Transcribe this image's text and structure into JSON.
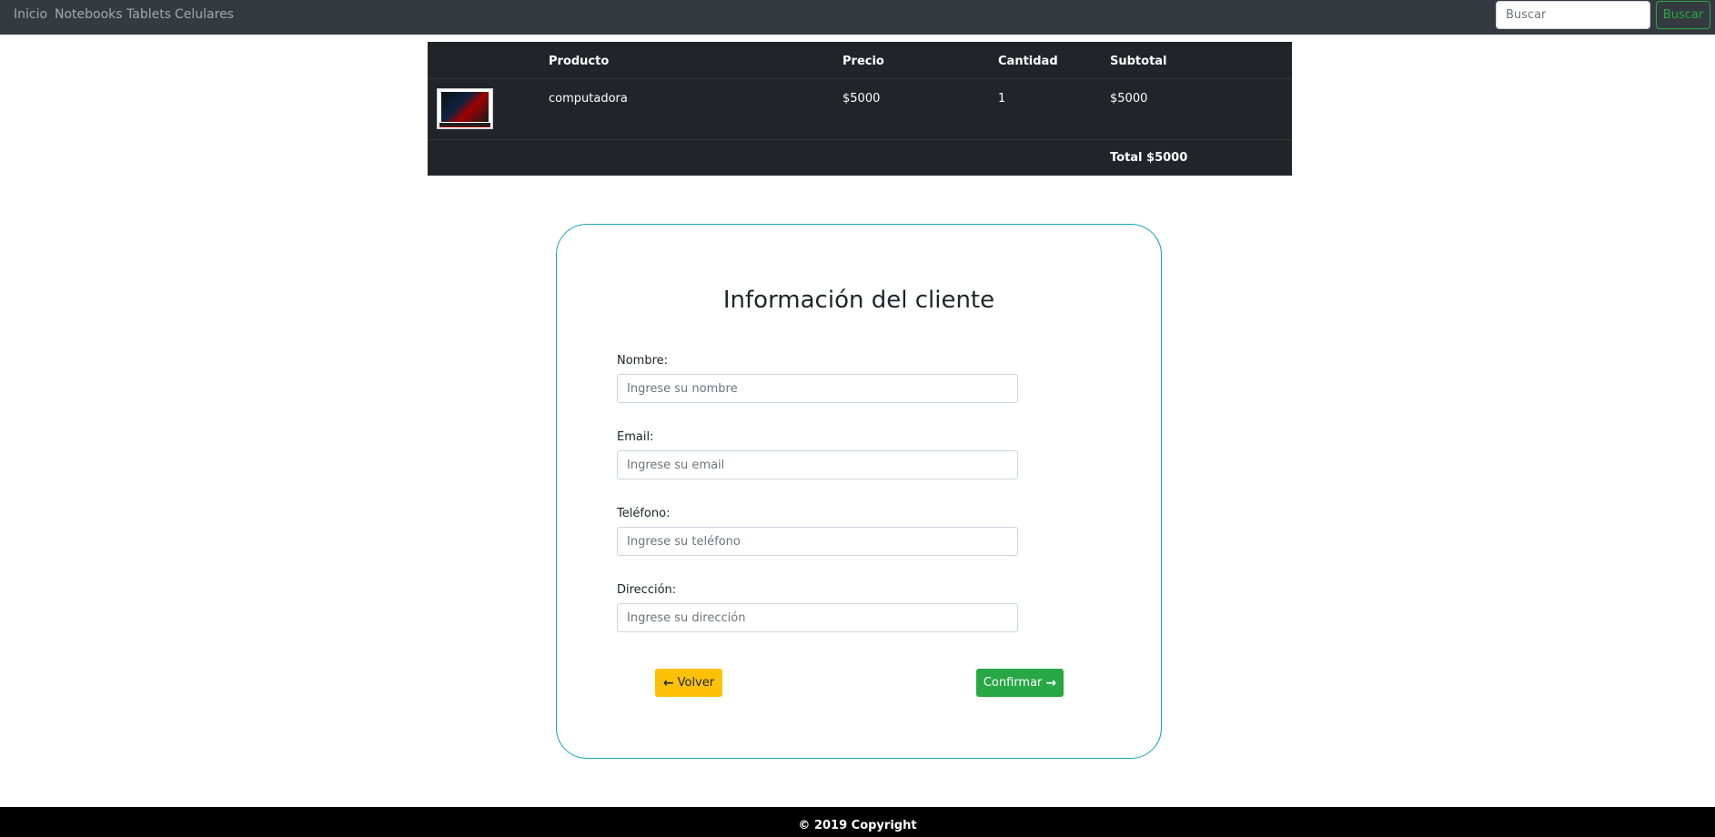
{
  "navbar": {
    "links": [
      "Inicio",
      "Notebooks",
      "Tablets",
      "Celulares"
    ],
    "search_placeholder": "Buscar",
    "search_button": "Buscar"
  },
  "cart": {
    "headers": {
      "producto": "Producto",
      "precio": "Precio",
      "cantidad": "Cantidad",
      "subtotal": "Subtotal"
    },
    "rows": [
      {
        "producto": "computadora",
        "precio": "$5000",
        "cantidad": "1",
        "subtotal": "$5000",
        "thumbnail_icon": "laptop-image"
      }
    ],
    "total": "Total $5000"
  },
  "form": {
    "title": "Información del cliente",
    "fields": [
      {
        "label": "Nombre:",
        "placeholder": "Ingrese su nombre"
      },
      {
        "label": "Email:",
        "placeholder": "Ingrese su email"
      },
      {
        "label": "Teléfono:",
        "placeholder": "Ingrese su teléfono"
      },
      {
        "label": "Dirección:",
        "placeholder": "Ingrese su dirección"
      }
    ],
    "back_button": "Volver",
    "confirm_button": "Confirmar",
    "back_icon": "arrow-left-icon",
    "confirm_icon": "arrow-right-icon"
  },
  "colors": {
    "navbar": "#343a40",
    "table": "#212529",
    "card_border": "#17a2b8",
    "warning": "#ffc107",
    "success": "#28a745",
    "footer": "#000000"
  },
  "footer": {
    "text": "© 2019 Copyright"
  }
}
